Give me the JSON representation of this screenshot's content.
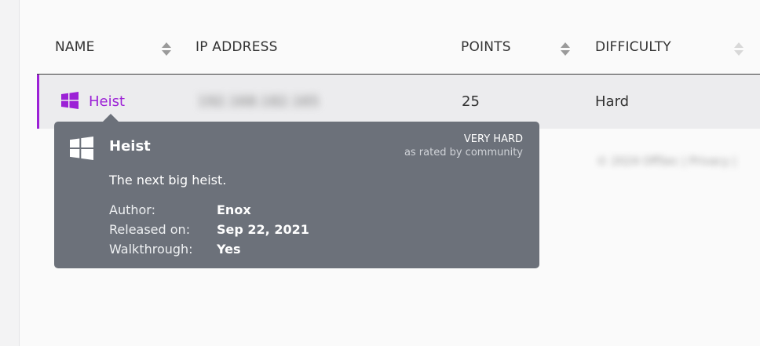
{
  "table": {
    "columns": {
      "name": "NAME",
      "ip": "IP ADDRESS",
      "points": "POINTS",
      "difficulty": "DIFFICULTY"
    },
    "row": {
      "name": "Heist",
      "ip": "192.168.182.165",
      "points": "25",
      "difficulty": "Hard",
      "os_icon": "windows-icon"
    }
  },
  "footer": {
    "text": "© 2024 OffSec | Privacy |"
  },
  "tooltip": {
    "title": "Heist",
    "rating": "VERY HARD",
    "rating_source": "as rated by community",
    "description": "The next big heist.",
    "author_label": "Author:",
    "author": "Enox",
    "released_label": "Released on:",
    "released": "Sep 22, 2021",
    "walkthrough_label": "Walkthrough:",
    "walkthrough": "Yes"
  },
  "colors": {
    "accent": "#9c21d6",
    "tooltip_bg": "#6c717a"
  }
}
